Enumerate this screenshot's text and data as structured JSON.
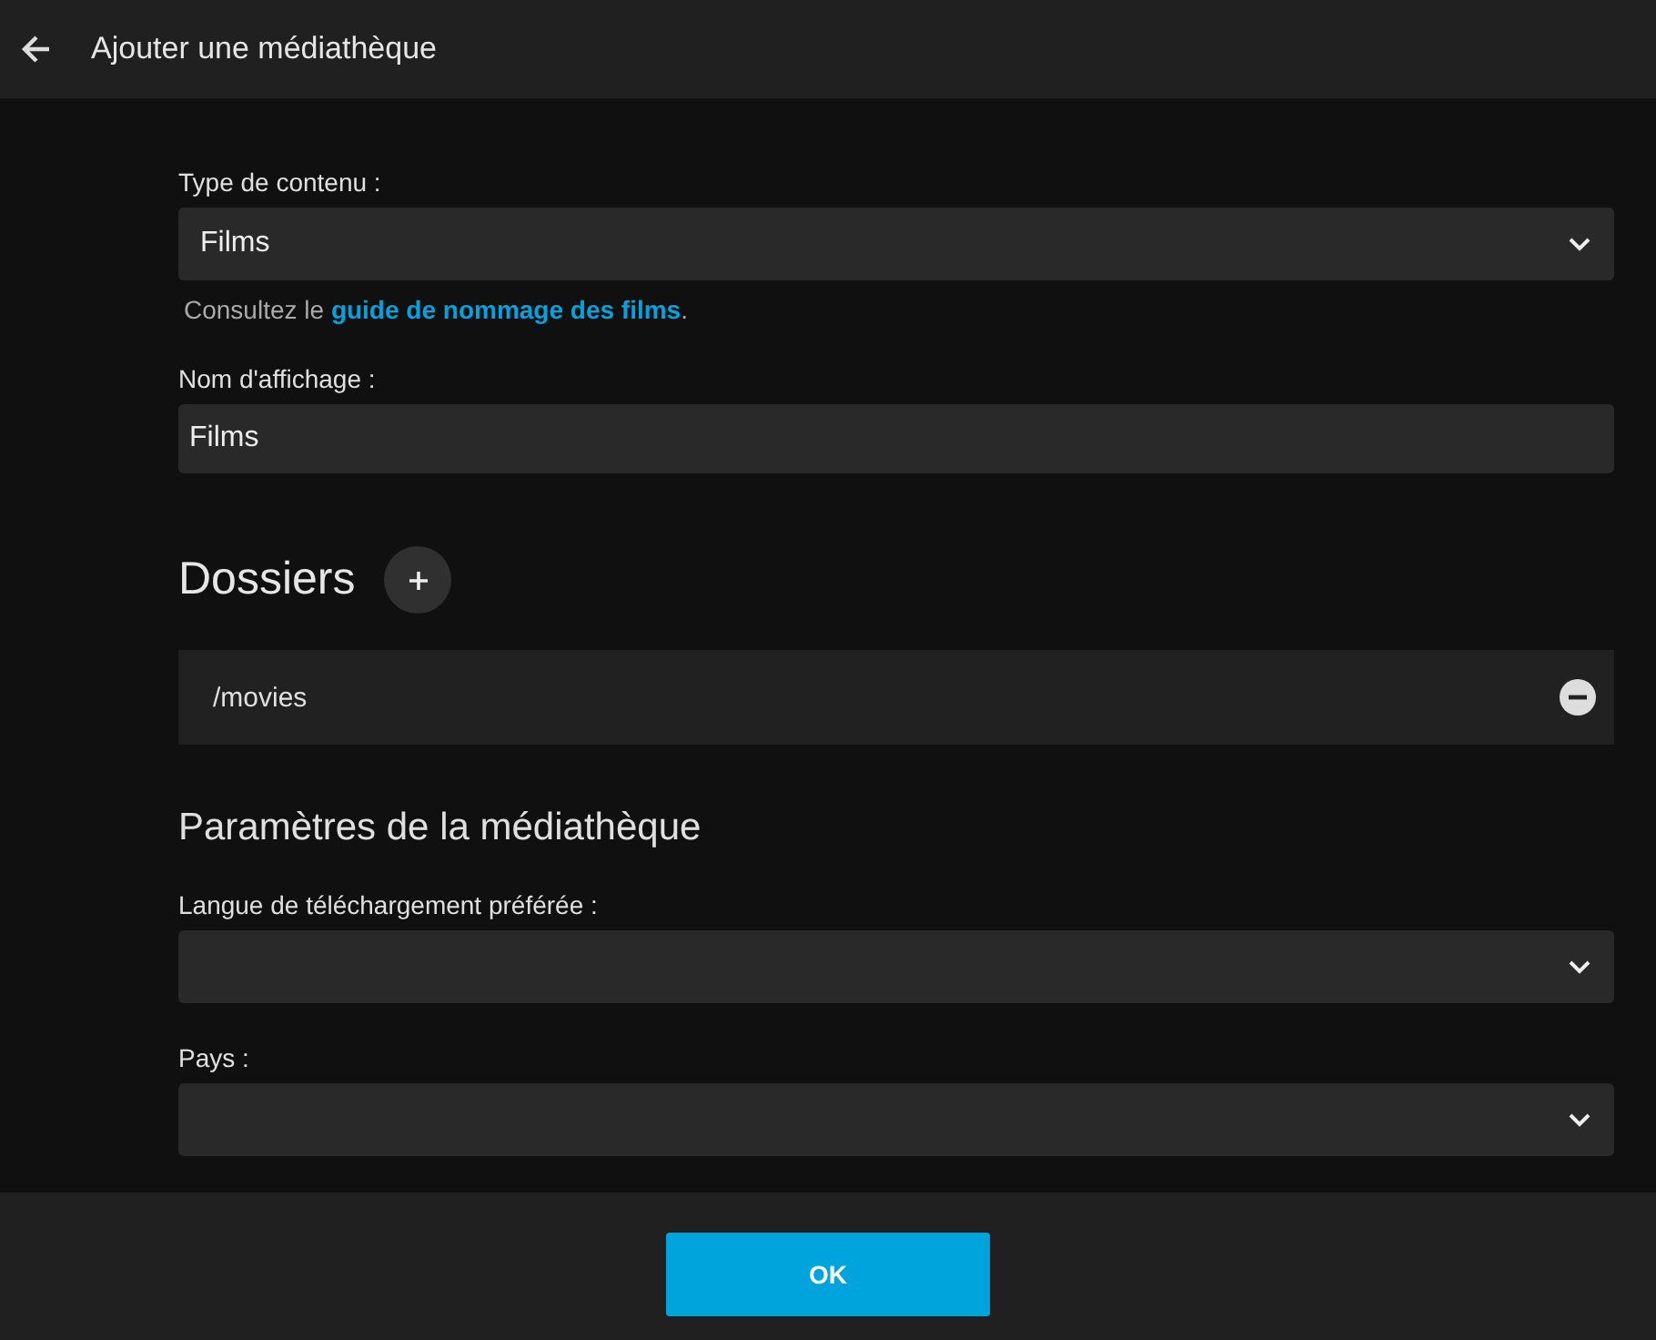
{
  "header": {
    "title": "Ajouter une médiathèque"
  },
  "top_fields": [
    {
      "kind": "select",
      "label": "Type de contenu :",
      "value": "Films",
      "help": {
        "before": "Consultez le ",
        "link": "guide de nommage des films",
        "after": "."
      }
    },
    {
      "kind": "text",
      "label": "Nom d'affichage :",
      "value": "Films"
    }
  ],
  "folders": {
    "title": "Dossiers",
    "items": [
      "/movies"
    ]
  },
  "settings": {
    "title": "Paramètres de la médiathèque",
    "fields": [
      {
        "kind": "select",
        "label": "Langue de téléchargement préférée :"
      },
      {
        "kind": "select",
        "label": "Pays :"
      }
    ]
  },
  "footer": {
    "button": "OK"
  }
}
